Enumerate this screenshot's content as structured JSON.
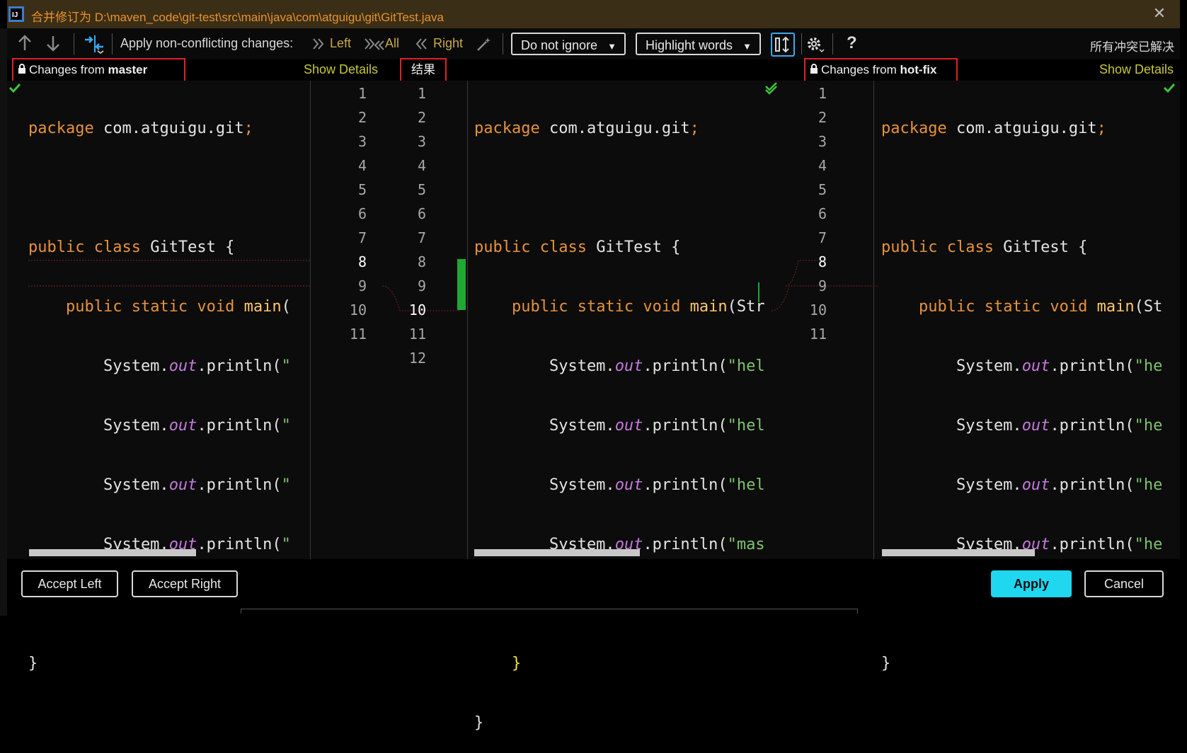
{
  "window": {
    "title": "合并修订为 D:\\maven_code\\git-test\\src\\main\\java\\com\\atguigu\\git\\GitTest.java",
    "close_glyph": "✕"
  },
  "toolbar": {
    "apply_label": "Apply non-conflicting changes:",
    "left_label": "Left",
    "all_label": "All",
    "right_label": "Right",
    "ignore_select": "Do not ignore",
    "highlight_select": "Highlight words",
    "help_glyph": "?",
    "status_text": "所有冲突已解决"
  },
  "headers": {
    "left_prefix": "Changes from ",
    "left_branch": "master",
    "left_show_details": "Show Details",
    "center_title": "结果",
    "right_prefix": "Changes from ",
    "right_branch": "hot-fix",
    "right_show_details": "Show Details"
  },
  "panes": {
    "left_lines": [
      "package com.atguigu.git;",
      "",
      "public class GitTest {",
      "    public static void main(",
      "        System.out.println(\"",
      "        System.out.println(\"",
      "        System.out.println(\"",
      "        System.out.println(\"",
      "    }",
      "}",
      ""
    ],
    "center_lines": [
      "package com.atguigu.git;",
      "",
      "public class GitTest {",
      "    public static void main(Str",
      "        System.out.println(\"hel",
      "        System.out.println(\"hel",
      "        System.out.println(\"hel",
      "        System.out.println(\"mas",
      "        System.out.println(\"hel",
      "    }",
      "}",
      ""
    ],
    "right_lines": [
      "package com.atguigu.git;",
      "",
      "public class GitTest {",
      "    public static void main(St",
      "        System.out.println(\"he",
      "        System.out.println(\"he",
      "        System.out.println(\"he",
      "        System.out.println(\"he",
      "    }",
      "}",
      ""
    ],
    "gutter_left_numbers": [
      "1",
      "2",
      "3",
      "4",
      "5",
      "6",
      "7",
      "8",
      "9",
      "10",
      "11"
    ],
    "gutter_center_numbers": [
      "1",
      "2",
      "3",
      "4",
      "5",
      "6",
      "7",
      "8",
      "9",
      "10",
      "11",
      "12"
    ],
    "gutter_right_numbers": [
      "1",
      "2",
      "3",
      "4",
      "5",
      "6",
      "7",
      "8",
      "9",
      "10",
      "11"
    ]
  },
  "buttons": {
    "accept_left": "Accept Left",
    "accept_right": "Accept Right",
    "apply": "Apply",
    "cancel": "Cancel"
  },
  "colors": {
    "accent": "#1fd8f0",
    "conflict_box": "#e0202a",
    "added_marker": "#1fa832",
    "keyword": "#e8923a"
  },
  "icons": [
    "app-icon",
    "arrow-up-icon",
    "arrow-down-icon",
    "merge-icon",
    "apply-left-icon",
    "apply-all-icon",
    "apply-right-icon",
    "magic-wand-icon",
    "sync-scroll-icon",
    "gear-icon",
    "help-icon",
    "lock-icon",
    "checkmark-icon",
    "close-icon"
  ]
}
